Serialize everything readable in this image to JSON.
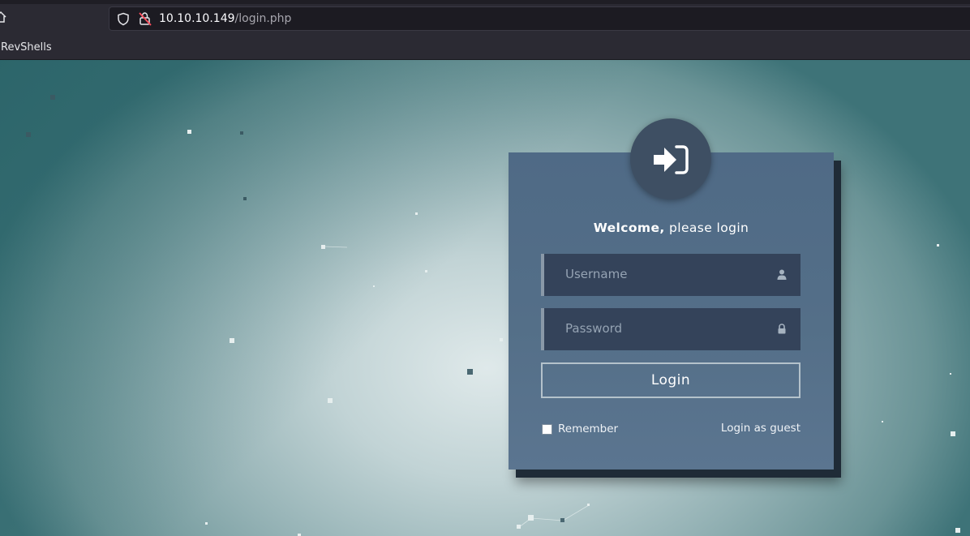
{
  "browser": {
    "url_host": "10.10.10.149",
    "url_path": "/login.php",
    "bookmarks": [
      {
        "label": "RevShells"
      }
    ]
  },
  "login": {
    "welcome_bold": "Welcome,",
    "welcome_rest": " please login",
    "username_placeholder": "Username",
    "password_placeholder": "Password",
    "login_label": "Login",
    "remember_label": "Remember",
    "guest_label": "Login as guest"
  },
  "colors": {
    "card": "#546f88",
    "field": "#34435a",
    "avatar": "#3e4f63",
    "chrome": "#2b2a33"
  },
  "icons": {
    "home": "home-icon",
    "shield": "shield-icon",
    "insecure_lock": "insecure-lock-icon",
    "signin": "sign-in-icon",
    "user": "user-icon",
    "lock": "lock-icon"
  }
}
